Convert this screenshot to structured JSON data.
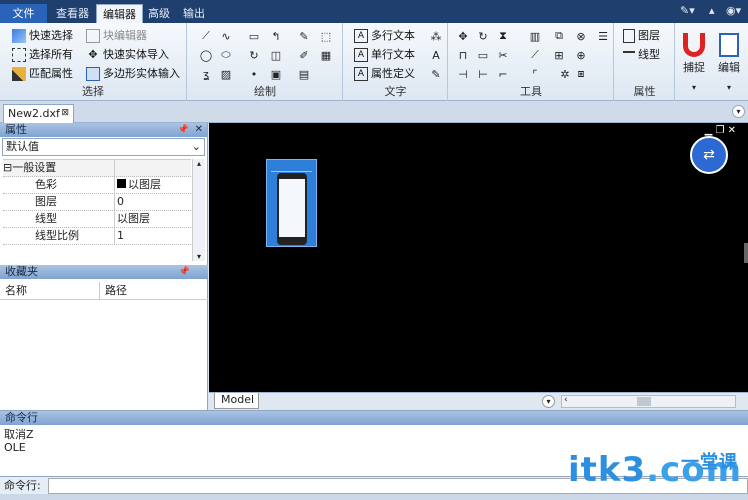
{
  "menubar": {
    "file": "文件",
    "tabs": [
      "查看器",
      "编辑器",
      "高级",
      "输出"
    ],
    "active_tab": "编辑器"
  },
  "ribbon": {
    "select": {
      "label": "选择",
      "items": [
        "快速选择",
        "选择所有",
        "匹配属性",
        "块编辑器",
        "快速实体导入",
        "多边形实体输入"
      ]
    },
    "draw": {
      "label": "绘制"
    },
    "text": {
      "label": "文字",
      "items": [
        "多行文本",
        "单行文本",
        "属性定义"
      ]
    },
    "tools": {
      "label": "工具"
    },
    "props": {
      "label": "属性",
      "items": [
        "图层",
        "线型"
      ]
    },
    "snap": "捕捉",
    "edit": "编辑"
  },
  "doc_tab": "New2.dxf",
  "properties": {
    "title": "属性",
    "combo": "默认值",
    "section": "一般设置",
    "rows": [
      {
        "k": "色彩",
        "v": "以图层"
      },
      {
        "k": "图层",
        "v": "0"
      },
      {
        "k": "线型",
        "v": "以图层"
      },
      {
        "k": "线型比例",
        "v": "1"
      }
    ]
  },
  "favorites": {
    "title": "收藏夹",
    "col_name": "名称",
    "col_path": "路径"
  },
  "model_tab": "Model",
  "command": {
    "title": "命令行",
    "history": [
      "取消Z",
      "OLE"
    ],
    "prompt": "命令行:"
  },
  "watermark": {
    "main": "itk3",
    "dot": ".com",
    "sub": "一堂课"
  },
  "colors": {
    "menubar": "#1f3f6e",
    "accent": "#2a63b8",
    "canvas": "#000000"
  }
}
